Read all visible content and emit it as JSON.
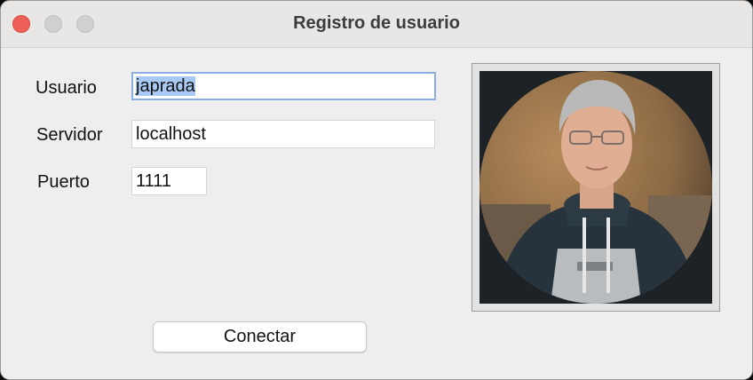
{
  "window": {
    "title": "Registro de usuario"
  },
  "form": {
    "user": {
      "label": "Usuario",
      "value": "japrada"
    },
    "server": {
      "label": "Servidor",
      "value": "localhost"
    },
    "port": {
      "label": "Puerto",
      "value": "1111"
    }
  },
  "avatar": {
    "icon": "user-avatar-photo"
  },
  "actions": {
    "connect_label": "Conectar"
  },
  "colors": {
    "close": "#ee5f57",
    "selection": "#a9c9f5",
    "focus_ring": "#8aaee3",
    "photo_bg": "#1d2226"
  }
}
